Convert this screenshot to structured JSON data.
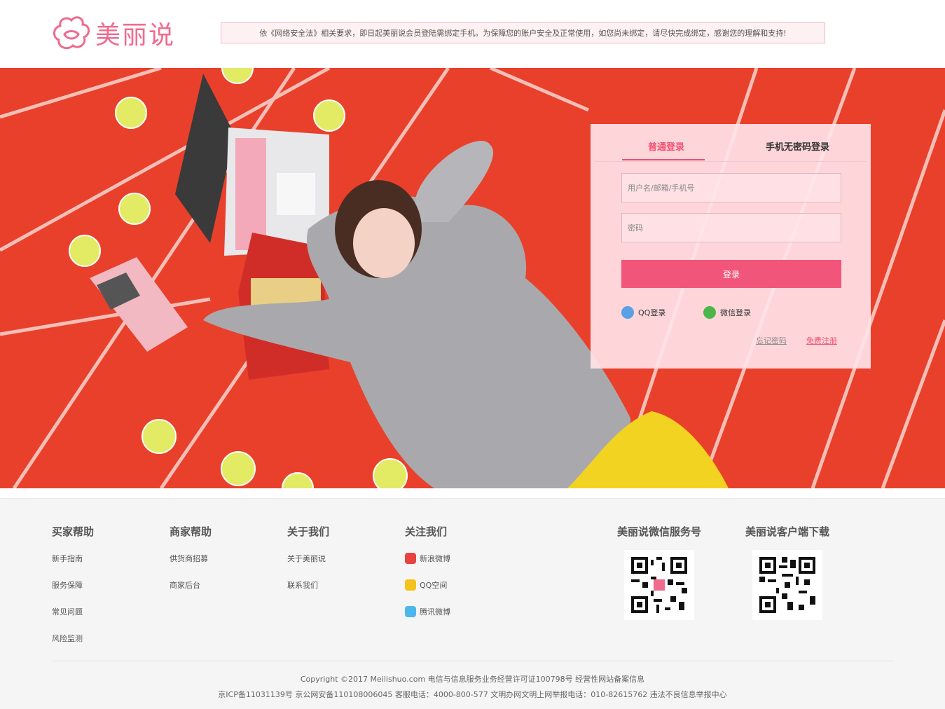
{
  "header": {
    "logo_text": "美丽说",
    "notice": "依《网络安全法》相关要求，即日起美丽说会员登陆需绑定手机。为保障您的账户安全及正常使用，如您尚未绑定，请尽快完成绑定，感谢您的理解和支持!"
  },
  "login": {
    "tab_normal": "普通登录",
    "tab_phone": "手机无密码登录",
    "username_placeholder": "用户名/邮箱/手机号",
    "password_placeholder": "密码",
    "submit_label": "登录",
    "qq_label": "QQ登录",
    "wechat_label": "微信登录",
    "forgot_label": "忘记密码",
    "register_label": "免费注册"
  },
  "footer": {
    "buyer": {
      "title": "买家帮助",
      "items": [
        "新手指南",
        "服务保障",
        "常见问题",
        "风险监测"
      ]
    },
    "seller": {
      "title": "商家帮助",
      "items": [
        "供货商招募",
        "商家后台"
      ]
    },
    "about": {
      "title": "关于我们",
      "items": [
        "关于美丽说",
        "联系我们"
      ]
    },
    "follow": {
      "title": "关注我们",
      "items": [
        "新浪微博",
        "QQ空间",
        "腾讯微博"
      ]
    },
    "wechat_qr_title": "美丽说微信服务号",
    "app_qr_title": "美丽说客户端下载",
    "copyright_line1": "Copyright ©2017 Meilishuo.com  电信与信息服务业务经营许可证100798号  经营性网站备案信息",
    "copyright_line2": "京ICP备11031139号   京公网安备110108006045    客服电话：4000-800-577   文明办网文明上网举报电话：010-82615762   违法不良信息举报中心"
  },
  "colors": {
    "brand": "#f06b8e",
    "accent": "#f24f73",
    "banner": "#e9402c"
  }
}
